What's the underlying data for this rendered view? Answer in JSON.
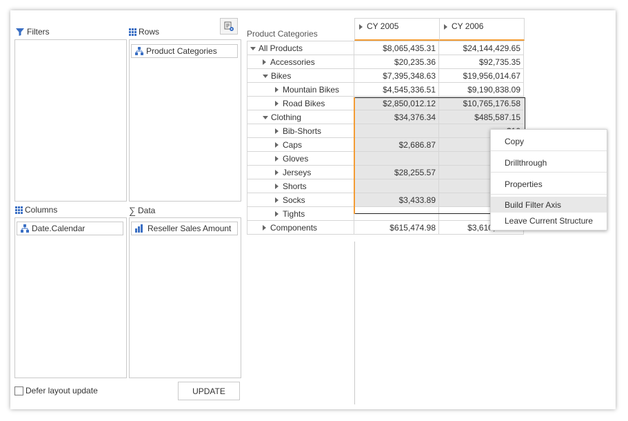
{
  "zones": {
    "filters": {
      "label": "Filters"
    },
    "rows": {
      "label": "Rows",
      "fields": [
        "Product Categories"
      ]
    },
    "columns": {
      "label": "Columns",
      "fields": [
        "Date.Calendar"
      ]
    },
    "data": {
      "label": "Data",
      "fields": [
        "Reseller Sales Amount"
      ]
    }
  },
  "controls": {
    "defer_label": "Defer layout update",
    "update_label": "UPDATE"
  },
  "grid": {
    "row_header_label": "Product Categories",
    "column_headers": [
      "CY 2005",
      "CY 2006"
    ],
    "rows": [
      {
        "label": "All Products",
        "expand": "expanded",
        "indent": 0,
        "v1": "$8,065,435.31",
        "v2": "$24,144,429.65"
      },
      {
        "label": "Accessories",
        "expand": "collapsed",
        "indent": 1,
        "v1": "$20,235.36",
        "v2": "$92,735.35"
      },
      {
        "label": "Bikes",
        "expand": "expanded",
        "indent": 1,
        "v1": "$7,395,348.63",
        "v2": "$19,956,014.67"
      },
      {
        "label": "Mountain Bikes",
        "expand": "collapsed",
        "indent": 2,
        "v1": "$4,545,336.51",
        "v2": "$9,190,838.09"
      },
      {
        "label": "Road Bikes",
        "expand": "collapsed",
        "indent": 2,
        "v1": "$2,850,012.12",
        "v2": "$10,765,176.58"
      },
      {
        "label": "Clothing",
        "expand": "expanded",
        "indent": 1,
        "v1": "$34,376.34",
        "v2": "$485,587.15"
      },
      {
        "label": "Bib-Shorts",
        "expand": "collapsed",
        "indent": 2,
        "v1": "",
        "v2": "$10"
      },
      {
        "label": "Caps",
        "expand": "collapsed",
        "indent": 2,
        "v1": "$2,686.87",
        "v2": "$"
      },
      {
        "label": "Gloves",
        "expand": "collapsed",
        "indent": 2,
        "v1": "",
        "v2": "$8"
      },
      {
        "label": "Jerseys",
        "expand": "collapsed",
        "indent": 2,
        "v1": "$28,255.57",
        "v2": "$11"
      },
      {
        "label": "Shorts",
        "expand": "collapsed",
        "indent": 2,
        "v1": "",
        "v2": "$4"
      },
      {
        "label": "Socks",
        "expand": "collapsed",
        "indent": 2,
        "v1": "$3,433.89",
        "v2": "$"
      },
      {
        "label": "Tights",
        "expand": "collapsed",
        "indent": 2,
        "v1": "",
        "v2": "$12"
      },
      {
        "label": "Components",
        "expand": "collapsed",
        "indent": 1,
        "v1": "$615,474.98",
        "v2": "$3,610,092.47"
      }
    ]
  },
  "context_menu": {
    "items": [
      "Copy",
      "Drillthrough",
      "Properties",
      "Build Filter Axis",
      "Leave Current Structure"
    ],
    "highlighted": "Build Filter Axis"
  },
  "colors": {
    "accent_orange": "#f39c34",
    "icon_blue": "#3a6fc4",
    "selection_gray": "#e6e6e6",
    "menu_hover": "#e8e8e8"
  }
}
